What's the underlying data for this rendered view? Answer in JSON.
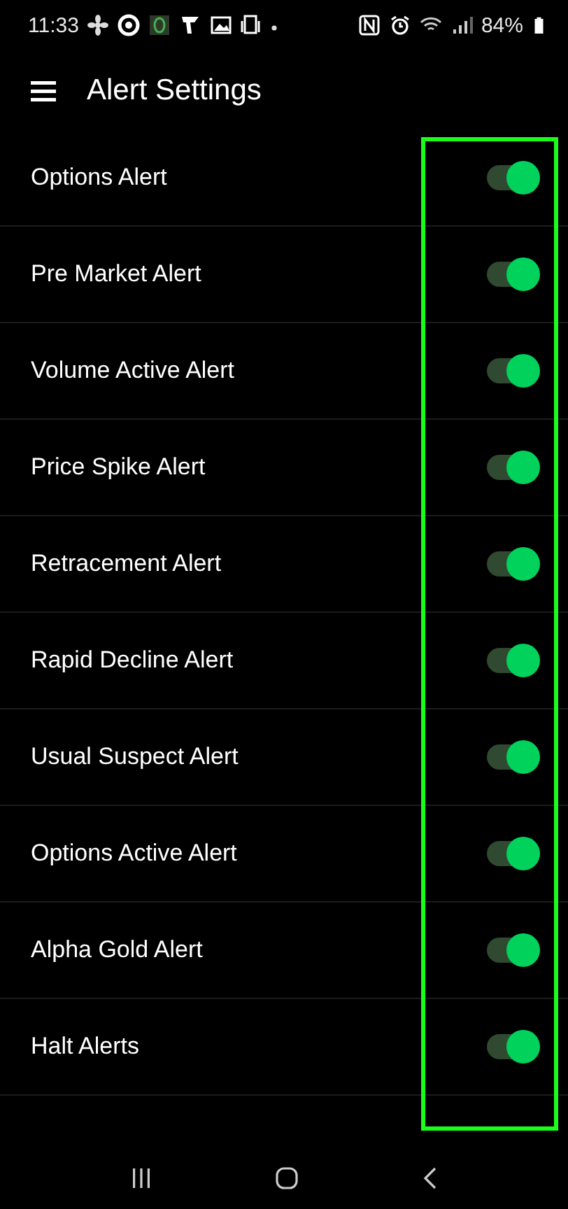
{
  "status_bar": {
    "time": "11:33",
    "battery": "84%"
  },
  "header": {
    "title": "Alert Settings"
  },
  "alerts": [
    {
      "label": "Options Alert",
      "on": true
    },
    {
      "label": "Pre Market Alert",
      "on": true
    },
    {
      "label": "Volume Active Alert",
      "on": true
    },
    {
      "label": "Price Spike Alert",
      "on": true
    },
    {
      "label": "Retracement Alert",
      "on": true
    },
    {
      "label": "Rapid Decline Alert",
      "on": true
    },
    {
      "label": "Usual Suspect Alert",
      "on": true
    },
    {
      "label": "Options Active Alert",
      "on": true
    },
    {
      "label": "Alpha Gold Alert",
      "on": true
    },
    {
      "label": "Halt Alerts",
      "on": true
    }
  ]
}
